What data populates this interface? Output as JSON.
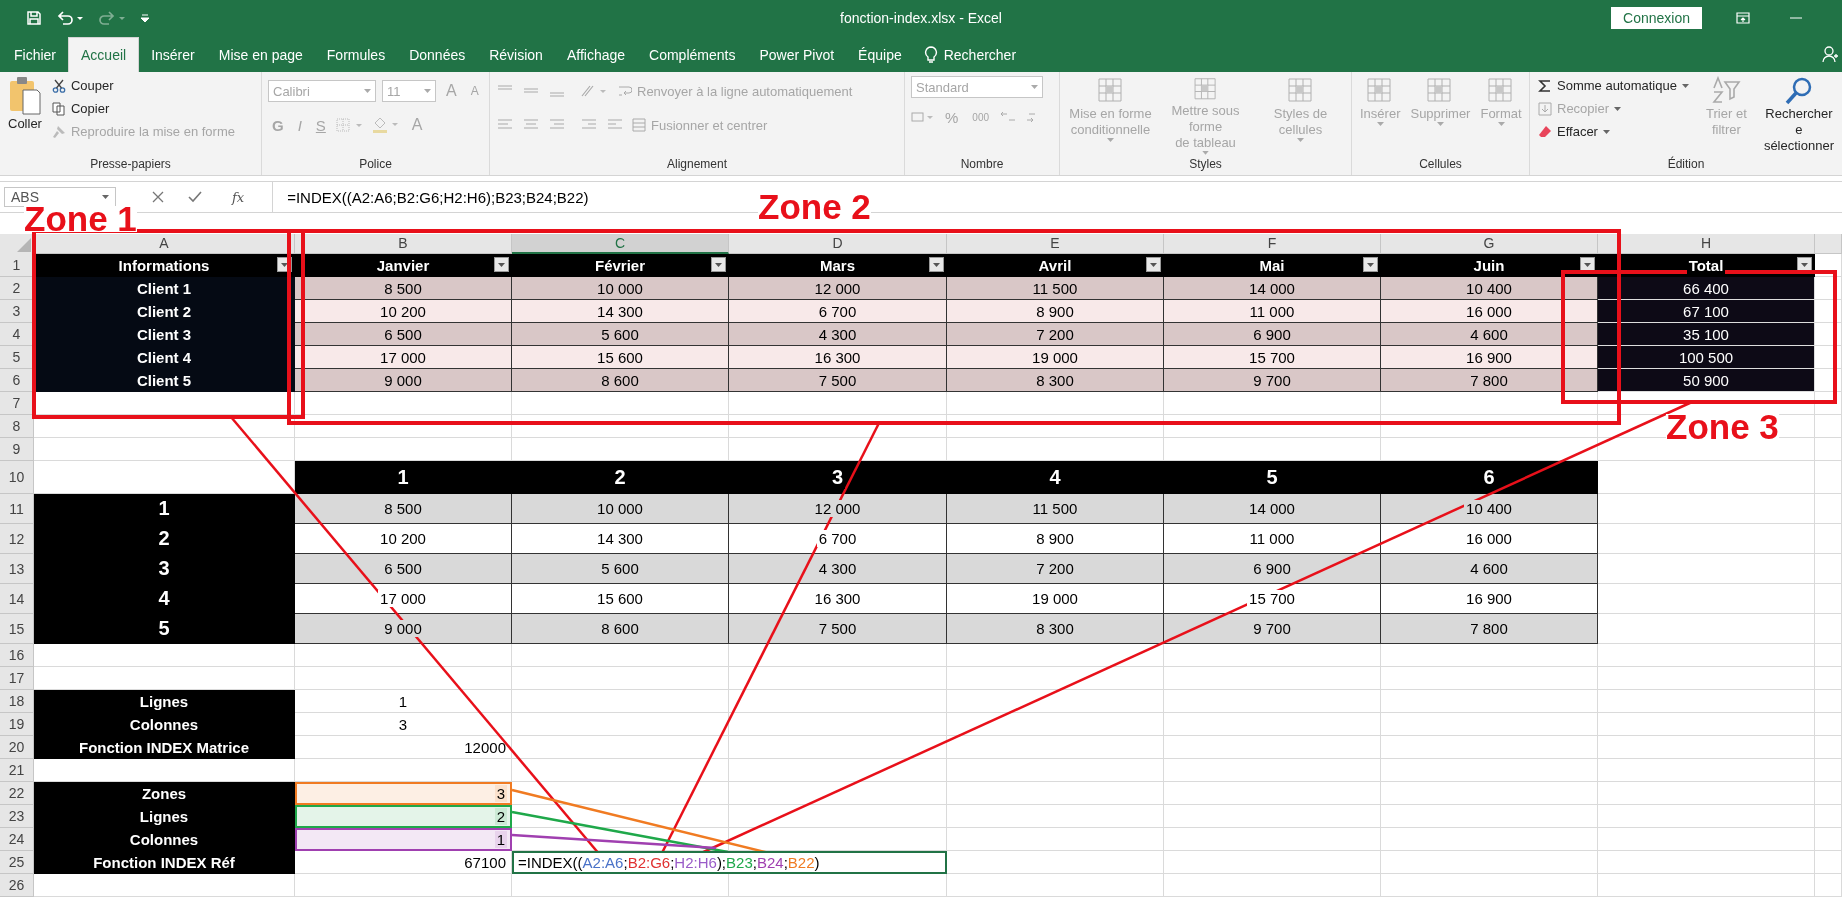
{
  "title_bar": {
    "title": "fonction-index.xlsx  -  Excel",
    "sign_in": "Connexion"
  },
  "menu_tabs": [
    {
      "label": "Fichier",
      "selected": false
    },
    {
      "label": "Accueil",
      "selected": true
    },
    {
      "label": "Insérer",
      "selected": false
    },
    {
      "label": "Mise en page",
      "selected": false
    },
    {
      "label": "Formules",
      "selected": false
    },
    {
      "label": "Données",
      "selected": false
    },
    {
      "label": "Révision",
      "selected": false
    },
    {
      "label": "Affichage",
      "selected": false
    },
    {
      "label": "Compléments",
      "selected": false
    },
    {
      "label": "Power Pivot",
      "selected": false
    },
    {
      "label": "Équipe",
      "selected": false
    }
  ],
  "tell_me": "Rechercher",
  "ribbon": [
    {
      "kind": "clipboard",
      "label": "Presse-papiers",
      "commands": [
        {
          "label": "Coller",
          "disabled": false
        },
        {
          "label": "Couper",
          "disabled": false
        },
        {
          "label": "Copier",
          "disabled": false
        },
        {
          "label": "Reproduire la mise en forme",
          "disabled": true
        }
      ]
    },
    {
      "kind": "font",
      "label": "Police",
      "commands": [
        {
          "label": "Calibri",
          "disabled": true
        },
        {
          "label": "11",
          "disabled": true
        },
        {
          "label": "A",
          "disabled": true
        },
        {
          "label": "A",
          "disabled": true
        },
        {
          "label": "G",
          "disabled": true
        },
        {
          "label": "I",
          "disabled": true
        },
        {
          "label": "S",
          "disabled": true
        },
        {
          "label": "A",
          "disabled": true
        }
      ]
    },
    {
      "kind": "alignment",
      "label": "Alignement",
      "commands": [
        {
          "label": "Renvoyer à la ligne automatiquement",
          "disabled": true
        },
        {
          "label": "Fusionner et centrer",
          "disabled": true
        }
      ]
    },
    {
      "kind": "number",
      "label": "Nombre",
      "commands": [
        {
          "label": "Standard",
          "disabled": true
        },
        {
          "label": "%",
          "disabled": true
        },
        {
          "label": "000",
          "disabled": true
        }
      ]
    },
    {
      "kind": "large",
      "label": "Styles",
      "commands": [
        {
          "lines": [
            "Mise en forme",
            "conditionnelle"
          ],
          "disabled": true
        },
        {
          "lines": [
            "Mettre sous forme",
            "de tableau"
          ],
          "disabled": true
        },
        {
          "lines": [
            "Styles de",
            "cellules"
          ],
          "disabled": true
        }
      ]
    },
    {
      "kind": "large",
      "label": "Cellules",
      "commands": [
        {
          "lines": [
            "Insérer"
          ],
          "disabled": true
        },
        {
          "lines": [
            "Supprimer"
          ],
          "disabled": true
        },
        {
          "lines": [
            "Format"
          ],
          "disabled": true
        }
      ]
    },
    {
      "kind": "editing",
      "label": "Édition",
      "commands": [
        {
          "label": "Somme automatique",
          "disabled": false
        },
        {
          "label": "Recopier",
          "disabled": true
        },
        {
          "label": "Effacer",
          "disabled": false
        },
        {
          "lines": [
            "Trier et",
            "filtrer"
          ],
          "disabled": true
        },
        {
          "lines": [
            "Rechercher e",
            "sélectionner"
          ],
          "disabled": false
        }
      ]
    }
  ],
  "formula_bar": {
    "name_box": "ABS",
    "function_label": "fx",
    "formula": "=INDEX((A2:A6;B2:G6;H2:H6);B23;B24;B22)"
  },
  "sheet": {
    "columns": [
      {
        "label": "A",
        "selected": false
      },
      {
        "label": "B",
        "selected": false
      },
      {
        "label": "C",
        "selected": true
      },
      {
        "label": "D",
        "selected": false
      },
      {
        "label": "E",
        "selected": false
      },
      {
        "label": "F",
        "selected": false
      },
      {
        "label": "G",
        "selected": false
      },
      {
        "label": "H",
        "selected": false
      }
    ],
    "row_numbers": [
      "1",
      "2",
      "3",
      "4",
      "5",
      "6",
      "7",
      "8",
      "9",
      "10",
      "11",
      "12",
      "13",
      "14",
      "15",
      "16",
      "17",
      "18",
      "19",
      "20",
      "21",
      "22",
      "23",
      "24",
      "25",
      "26"
    ],
    "sales_table": {
      "headers": [
        "Informations",
        "Janvier",
        "Février",
        "Mars",
        "Avril",
        "Mai",
        "Juin",
        "Total"
      ],
      "rows": [
        {
          "client": "Client 1",
          "values": [
            "8 500",
            "10 000",
            "12 000",
            "11 500",
            "14 000",
            "10 400"
          ],
          "total": "66 400"
        },
        {
          "client": "Client 2",
          "values": [
            "10 200",
            "14 300",
            "6 700",
            "8 900",
            "11 000",
            "16 000"
          ],
          "total": "67 100"
        },
        {
          "client": "Client 3",
          "values": [
            "6 500",
            "5 600",
            "4 300",
            "7 200",
            "6 900",
            "4 600"
          ],
          "total": "35 100"
        },
        {
          "client": "Client 4",
          "values": [
            "17 000",
            "15 600",
            "16 300",
            "19 000",
            "15 700",
            "16 900"
          ],
          "total": "100 500"
        },
        {
          "client": "Client 5",
          "values": [
            "9 000",
            "8 600",
            "7 500",
            "8 300",
            "9 700",
            "7 800"
          ],
          "total": "50 900"
        }
      ]
    },
    "index_matrix": {
      "column_headers": [
        "1",
        "2",
        "3",
        "4",
        "5",
        "6"
      ],
      "row_headers": [
        "1",
        "2",
        "3",
        "4",
        "5"
      ],
      "rows": [
        [
          "8 500",
          "10 000",
          "12 000",
          "11 500",
          "14 000",
          "10 400"
        ],
        [
          "10 200",
          "14 300",
          "6 700",
          "8 900",
          "11 000",
          "16 000"
        ],
        [
          "6 500",
          "5 600",
          "4 300",
          "7 200",
          "6 900",
          "4 600"
        ],
        [
          "17 000",
          "15 600",
          "16 300",
          "19 000",
          "15 700",
          "16 900"
        ],
        [
          "9 000",
          "8 600",
          "7 500",
          "8 300",
          "9 700",
          "7 800"
        ]
      ]
    },
    "matrix_params": [
      {
        "label": "Lignes",
        "value": "1"
      },
      {
        "label": "Colonnes",
        "value": "3"
      },
      {
        "label": "Fonction INDEX Matrice",
        "value": "12000"
      }
    ],
    "reference_params": [
      {
        "label": "Zones",
        "value": "3",
        "color": "#f07b22"
      },
      {
        "label": "Lignes",
        "value": "2",
        "color": "#1fa84a"
      },
      {
        "label": "Colonnes",
        "value": "1",
        "color": "#a040b0"
      }
    ],
    "reference_result": {
      "label": "Fonction INDEX Réf",
      "value": "67100",
      "formula_parts": [
        {
          "text": "=INDEX(("
        },
        {
          "text": "A2:A6",
          "color": "#4a72c8"
        },
        {
          "text": ";"
        },
        {
          "text": "B2:G6",
          "color": "#e03030"
        },
        {
          "text": ";"
        },
        {
          "text": "H2:H6",
          "color": "#9a5cc8"
        },
        {
          "text": ");"
        },
        {
          "text": "B23",
          "color": "#1fa84a"
        },
        {
          "text": ";"
        },
        {
          "text": "B24",
          "color": "#a040b0"
        },
        {
          "text": ";"
        },
        {
          "text": "B22",
          "color": "#f07b22"
        },
        {
          "text": ")"
        }
      ]
    }
  },
  "annotations": {
    "zones": [
      {
        "label": "Zone 1"
      },
      {
        "label": "Zone 2"
      },
      {
        "label": "Zone 3"
      }
    ]
  }
}
